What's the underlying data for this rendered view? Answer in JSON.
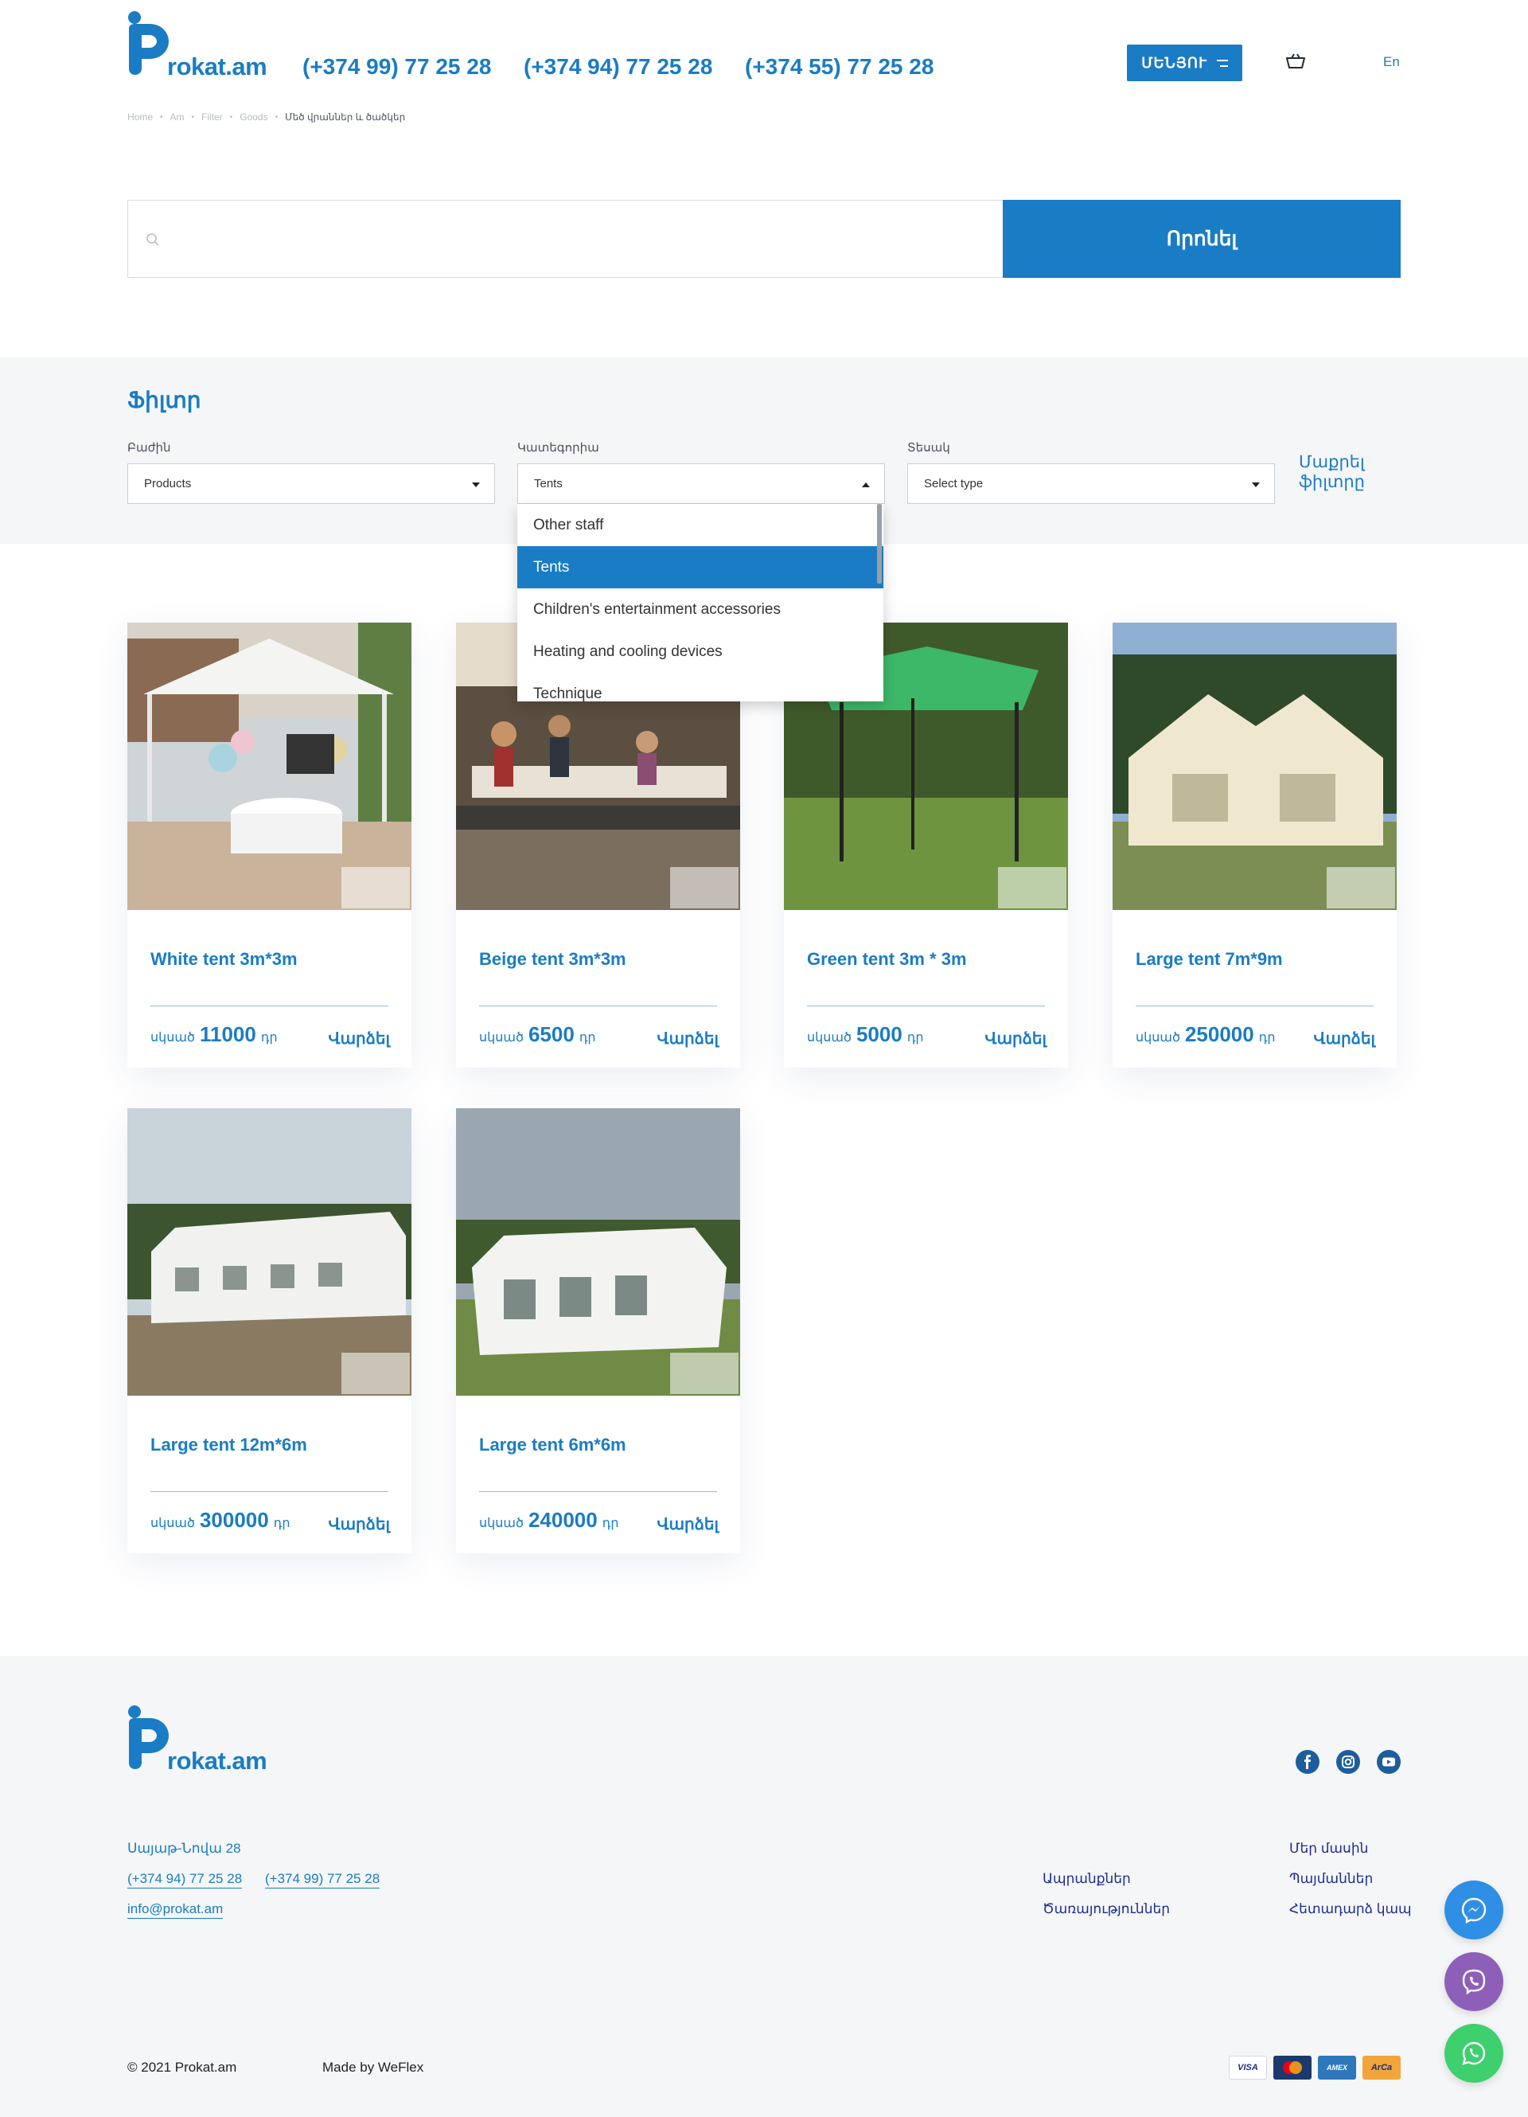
{
  "header": {
    "logo_text": "rokat.am",
    "phones": [
      "(+374 99) 77 25 28",
      "(+374 94) 77 25 28",
      "(+374 55) 77 25 28"
    ],
    "menu_label": "ՄԵՆՅՈՒ",
    "lang": "En"
  },
  "breadcrumb": [
    "Home",
    "Am",
    "Filter",
    "Goods",
    "Մեծ վրաններ և ծածկեր"
  ],
  "search": {
    "placeholder": "",
    "button": "Որոնել"
  },
  "filter": {
    "title": "Ֆիլտր",
    "section_label": "Բաժին",
    "section_value": "Products",
    "category_label": "Կատեգորիա",
    "category_value": "Tents",
    "type_label": "Տեսակ",
    "type_value": "Select type",
    "clear_label": "Մաքրել ֆիլտրը",
    "category_options": [
      "Other staff",
      "Tents",
      "Children's entertainment accessories",
      "Heating and cooling devices",
      "Technique"
    ],
    "selected_option": "Tents"
  },
  "products": [
    {
      "title": "White tent 3m*3m",
      "price_prefix": "սկսած",
      "price": "11000",
      "currency": "դր",
      "rent": "Վարձել"
    },
    {
      "title": "Beige tent 3m*3m",
      "price_prefix": "սկսած",
      "price": "6500",
      "currency": "դր",
      "rent": "Վարձել"
    },
    {
      "title": "Green tent 3m * 3m",
      "price_prefix": "սկսած",
      "price": "5000",
      "currency": "դր",
      "rent": "Վարձել"
    },
    {
      "title": "Large tent 7m*9m",
      "price_prefix": "սկսած",
      "price": "250000",
      "currency": "դր",
      "rent": "Վարձել"
    },
    {
      "title": "Large tent 12m*6m",
      "price_prefix": "սկսած",
      "price": "300000",
      "currency": "դր",
      "rent": "Վարձել"
    },
    {
      "title": "Large tent 6m*6m",
      "price_prefix": "սկսած",
      "price": "240000",
      "currency": "դր",
      "rent": "Վարձել"
    }
  ],
  "watermark": "Prokat.am",
  "footer": {
    "logo_text": "rokat.am",
    "address": "Սայաթ-Նովա 28",
    "phones": [
      "(+374 94) 77 25 28",
      "(+374 99) 77 25 28"
    ],
    "email": "info@prokat.am",
    "links_col1": [
      "Ապրանքներ",
      "Ծառայություններ"
    ],
    "links_col2": [
      "Մեր մասին",
      "Պայմաններ",
      "Հետադարձ կապ"
    ],
    "copyright": "© 2021 Prokat.am",
    "made_by": "Made by WeFlex",
    "payments": [
      "VISA",
      "MasterCard",
      "AMEX",
      "ArCa"
    ]
  },
  "colors": {
    "primary": "#1a7cc4",
    "footer_bg": "#f5f6f7",
    "messenger": "#2f8fe6",
    "viber": "#8e5fb8",
    "whatsapp": "#3ecf6f"
  }
}
